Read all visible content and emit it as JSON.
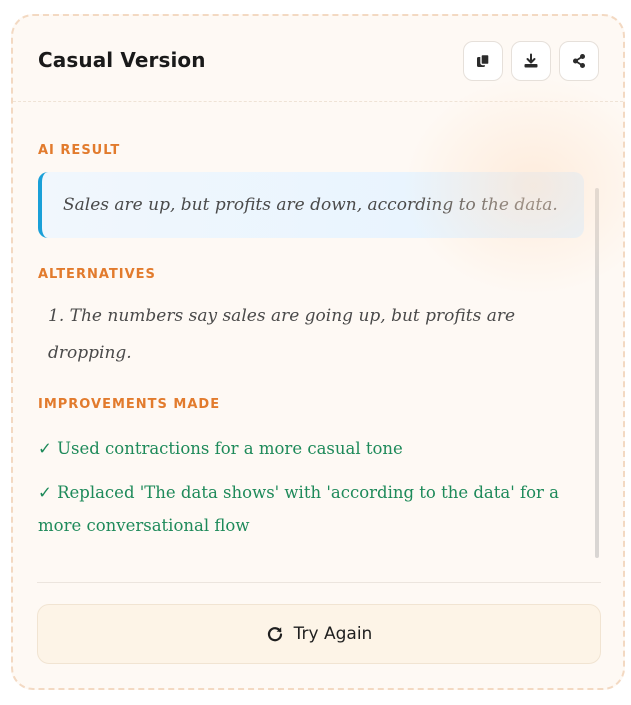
{
  "header": {
    "title": "Casual Version",
    "actions": [
      {
        "name": "copy",
        "icon": "copy-icon"
      },
      {
        "name": "download",
        "icon": "download-icon"
      },
      {
        "name": "share",
        "icon": "share-icon"
      }
    ]
  },
  "result": {
    "label": "AI RESULT",
    "text": "Sales are up, but profits are down, according to the data."
  },
  "alternatives": {
    "label": "ALTERNATIVES",
    "items": [
      "1. The numbers say sales are going up, but profits are dropping."
    ]
  },
  "improvements": {
    "label": "IMPROVEMENTS MADE",
    "items": [
      "✓ Used contractions for a more casual tone",
      "✓ Replaced 'The data shows' with 'according to the data' for a more conversational flow"
    ]
  },
  "footer": {
    "try_again_label": "Try Again",
    "try_again_icon": "refresh-icon"
  },
  "colors": {
    "accent_orange": "#e27b2d",
    "accent_blue": "#1aa0d8",
    "success_green": "#1e8a5a",
    "card_background": "#fef9f4"
  }
}
